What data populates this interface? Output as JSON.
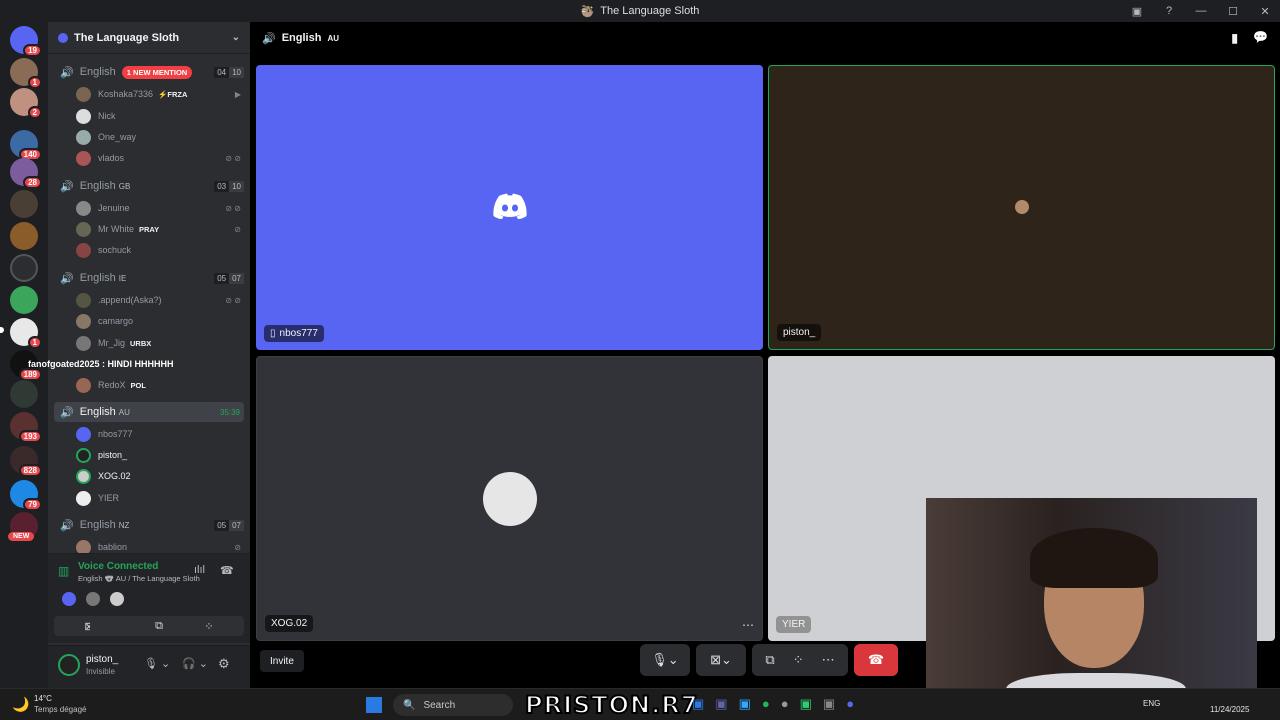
{
  "window": {
    "title": "The Language Sloth"
  },
  "server_rail": {
    "badges": [
      "19",
      "1",
      "2",
      "140",
      "28",
      "1",
      "189",
      "193",
      "828",
      "79"
    ],
    "new_label": "NEW"
  },
  "guild": {
    "name": "The Language Sloth"
  },
  "channels": [
    {
      "name": "English",
      "flag": "",
      "mention": "1 NEW MENTION",
      "count_a": "04",
      "count_b": "10",
      "users": [
        {
          "name": "Koshaka7336",
          "tag": "⚡FRZA"
        },
        {
          "name": "Nick",
          "tag": ""
        },
        {
          "name": "One_way",
          "tag": ""
        },
        {
          "name": "vlados",
          "tag": ""
        }
      ]
    },
    {
      "name": "English",
      "flag": "GB",
      "mention": "",
      "count_a": "03",
      "count_b": "10",
      "users": [
        {
          "name": "Jenuine",
          "tag": ""
        },
        {
          "name": "Mr White",
          "tag": "PRAY"
        },
        {
          "name": "sochuck",
          "tag": ""
        }
      ]
    },
    {
      "name": "English",
      "flag": "IE",
      "mention": "",
      "count_a": "05",
      "count_b": "07",
      "users": [
        {
          "name": ".append(Aska?)",
          "tag": ""
        },
        {
          "name": "camargo",
          "tag": ""
        },
        {
          "name": "Mr_Jig",
          "tag": "URBX"
        },
        {
          "name": "fanofgoated2025 : HINDI HHHHHH",
          "tag": ""
        },
        {
          "name": "RedoX",
          "tag": "POL"
        }
      ]
    },
    {
      "name": "English",
      "flag": "AU",
      "mention": "",
      "timer": "35:39",
      "users": [
        {
          "name": "nbos777",
          "tag": ""
        },
        {
          "name": "piston_",
          "tag": ""
        },
        {
          "name": "XOG.02",
          "tag": ""
        },
        {
          "name": "YIER",
          "tag": ""
        }
      ]
    },
    {
      "name": "English",
      "flag": "NZ",
      "mention": "",
      "count_a": "05",
      "count_b": "07",
      "users": [
        {
          "name": "bablion",
          "tag": ""
        }
      ]
    }
  ],
  "voice": {
    "status": "Voice Connected",
    "location": "English 🐨 AU / The Language Sloth"
  },
  "user": {
    "name": "piston_",
    "status": "Invisible"
  },
  "stage": {
    "channel": "English",
    "flag": "AU",
    "tiles": [
      {
        "name": "nbos777"
      },
      {
        "name": "piston_"
      },
      {
        "name": "XOG.02"
      },
      {
        "name": "YIER"
      }
    ],
    "invite_label": "Invite"
  },
  "taskbar": {
    "weather_temp": "14°C",
    "weather_desc": "Temps dégagé",
    "search_placeholder": "Search",
    "lang": "ENG",
    "date": "11/24/2025",
    "watermark": "PRISTON.R7"
  },
  "colors": {
    "blurple": "#5865f2",
    "green": "#23a55a",
    "red": "#da373c"
  }
}
